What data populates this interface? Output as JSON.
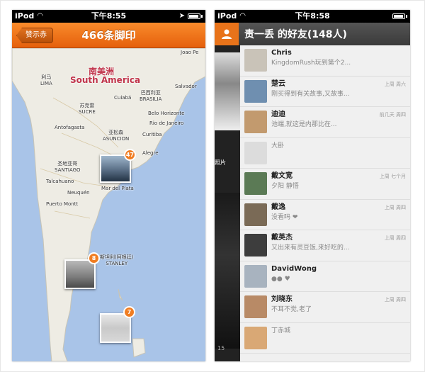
{
  "left": {
    "status": {
      "carrier": "iPod",
      "time": "下午8:55"
    },
    "nav": {
      "back": "赞示赤",
      "title": "466条脚印"
    },
    "map": {
      "continent_cn": "南美洲",
      "continent_en": "South America",
      "places": [
        {
          "cn": "",
          "en": "Joao Pe"
        },
        {
          "cn": "利马",
          "en": "LIMA"
        },
        {
          "cn": "苏克雷",
          "en": "SUCRE"
        },
        {
          "cn": "",
          "en": "Cuiabá"
        },
        {
          "cn": "巴西利亚",
          "en": "BRASILIA"
        },
        {
          "cn": "",
          "en": "Salvador"
        },
        {
          "cn": "",
          "en": "Belo Horizonte"
        },
        {
          "cn": "",
          "en": "Rio de Janeiro"
        },
        {
          "cn": "",
          "en": "Antofagasta"
        },
        {
          "cn": "亚松森",
          "en": "ASUNCION"
        },
        {
          "cn": "",
          "en": "Curitiba"
        },
        {
          "cn": "",
          "en": "Alegre"
        },
        {
          "cn": "圣地亚哥",
          "en": "SANTIAGO"
        },
        {
          "cn": "",
          "en": "Talcahuano"
        },
        {
          "cn": "",
          "en": "Neuquén"
        },
        {
          "cn": "",
          "en": "Puerto Montt"
        },
        {
          "cn": "",
          "en": "Mar del Plata"
        },
        {
          "cn": "斯坦利(阿根廷)",
          "en": "STANLEY"
        }
      ],
      "pins": [
        {
          "count": "47"
        },
        {
          "count": "8"
        },
        {
          "count": "7"
        }
      ]
    }
  },
  "right": {
    "status": {
      "carrier": "iPod",
      "time": "下午8:58"
    },
    "nav": {
      "title": "责一丢 的好友(148人)"
    },
    "strip": {
      "text": "照片",
      "bottom": "15"
    },
    "friends": [
      {
        "name": "Chris",
        "msg": "KingdomRush玩到第个2...",
        "time": ""
      },
      {
        "name": "楚云",
        "msg": "刚买得到有关故事,又故事...",
        "time": "上周 周六"
      },
      {
        "name": "迪迪",
        "msg": "池端,就这是内那比在...",
        "time": "前几天 周四"
      },
      {
        "name": "",
        "msg": "大卧",
        "time": ""
      },
      {
        "name": "戴文宽",
        "msg": "夕阳 静悟",
        "time": "上周 七个月"
      },
      {
        "name": "戴逸",
        "msg": "没看吗 ❤︎",
        "time": "上周 周四"
      },
      {
        "name": "戴英杰",
        "msg": "又出来有灵豆饭,来好吃的...",
        "time": "上周 周四"
      },
      {
        "name": "DavidWong",
        "msg": "●● ♥",
        "time": ""
      },
      {
        "name": "刘晓东",
        "msg": "不耳不觉,老了",
        "time": "上周 周四"
      },
      {
        "name": "",
        "msg": "丁赤城",
        "time": ""
      }
    ]
  }
}
